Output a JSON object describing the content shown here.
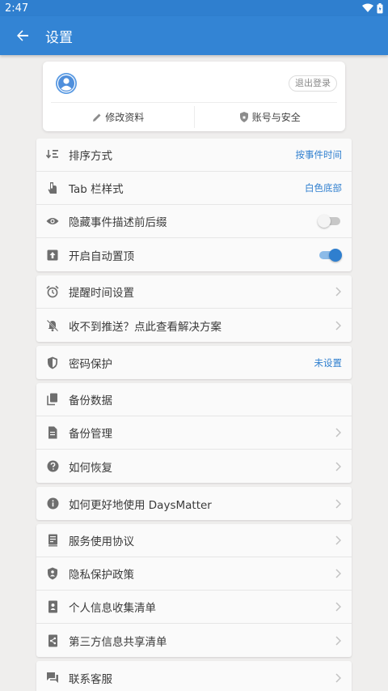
{
  "status_bar": {
    "time": "2:47"
  },
  "header": {
    "title": "设置"
  },
  "account": {
    "logout_label": "退出登录",
    "edit_profile_label": "修改资料",
    "account_security_label": "账号与安全"
  },
  "groups": [
    {
      "rows": [
        {
          "label": "排序方式",
          "value": "按事件时间",
          "icon": "sort-icon"
        },
        {
          "label": "Tab 栏样式",
          "value": "白色底部",
          "icon": "tab-style-icon"
        },
        {
          "label": "隐藏事件描述前后缀",
          "toggle": false,
          "icon": "eye-icon"
        },
        {
          "label": "开启自动置顶",
          "toggle": true,
          "icon": "pin-top-icon"
        }
      ]
    },
    {
      "rows": [
        {
          "label": "提醒时间设置",
          "icon": "alarm-icon"
        },
        {
          "label": "收不到推送？点此查看解决方案",
          "icon": "notification-off-icon"
        }
      ]
    },
    {
      "rows": [
        {
          "label": "密码保护",
          "value": "未设置",
          "icon": "shield-icon"
        }
      ]
    },
    {
      "rows": [
        {
          "label": "备份数据",
          "icon": "copy-icon"
        },
        {
          "label": "备份管理",
          "icon": "document-icon"
        },
        {
          "label": "如何恢复",
          "icon": "help-icon"
        }
      ]
    },
    {
      "rows": [
        {
          "label": "如何更好地使用 DaysMatter",
          "icon": "info-icon"
        }
      ]
    },
    {
      "rows": [
        {
          "label": "服务使用协议",
          "icon": "agreement-icon"
        },
        {
          "label": "隐私保护政策",
          "icon": "privacy-shield-icon"
        },
        {
          "label": "个人信息收集清单",
          "icon": "personal-info-icon"
        },
        {
          "label": "第三方信息共享清单",
          "icon": "share-icon"
        }
      ]
    },
    {
      "rows": [
        {
          "label": "联系客服",
          "icon": "chat-icon"
        }
      ]
    }
  ],
  "colors": {
    "primary": "#3384d4",
    "status_bar": "#2f7fcf",
    "accent_text": "#2f7fcf",
    "background": "#efeeed"
  }
}
